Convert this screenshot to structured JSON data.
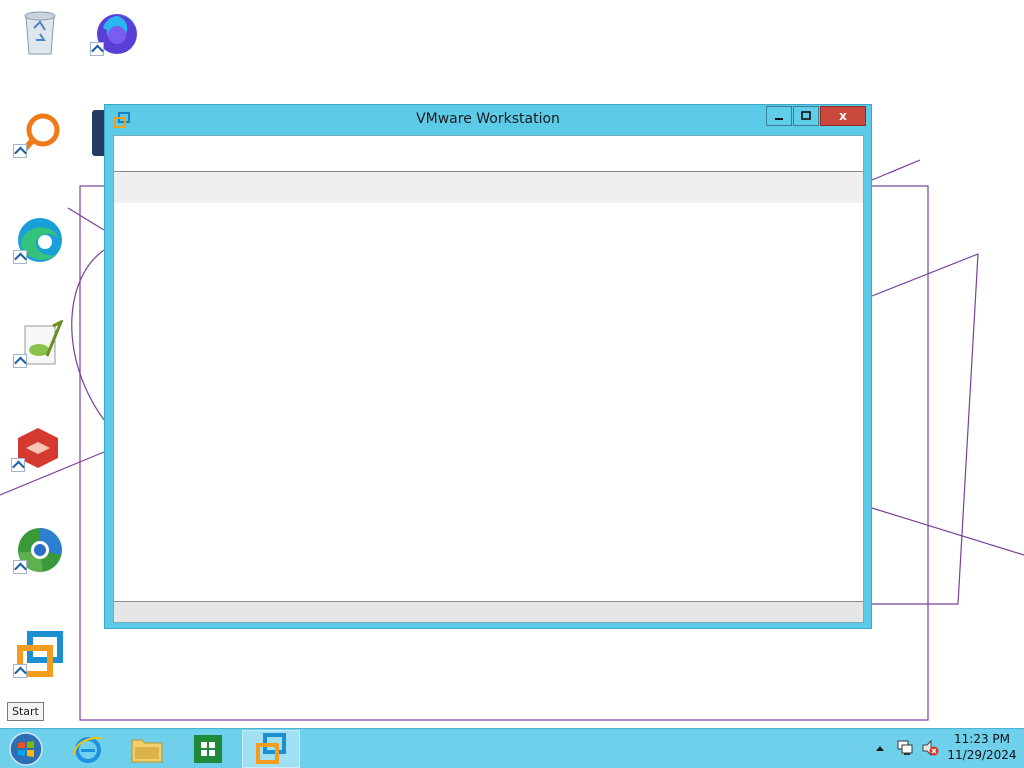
{
  "desktop": {
    "icons": [
      {
        "name": "recycle-bin"
      },
      {
        "name": "firefox"
      },
      {
        "name": "search-magnifier-app"
      },
      {
        "name": "edge"
      },
      {
        "name": "notepad-plus-plus"
      },
      {
        "name": "red-box-app"
      },
      {
        "name": "chrome-style-browser"
      },
      {
        "name": "vmware-workstation"
      }
    ]
  },
  "tooltip": {
    "text": "Start"
  },
  "window": {
    "title": "VMware Workstation",
    "minimize_label": "",
    "maximize_label": "",
    "close_label": "x",
    "accent": "#5ccbe8"
  },
  "taskbar": {
    "items": [
      "start-orb",
      "internet-explorer",
      "file-explorer",
      "store",
      "vmware-workstation"
    ],
    "clock_time": "11:23 PM",
    "clock_date": "11/29/2024",
    "accent": "#6fd0ec"
  }
}
